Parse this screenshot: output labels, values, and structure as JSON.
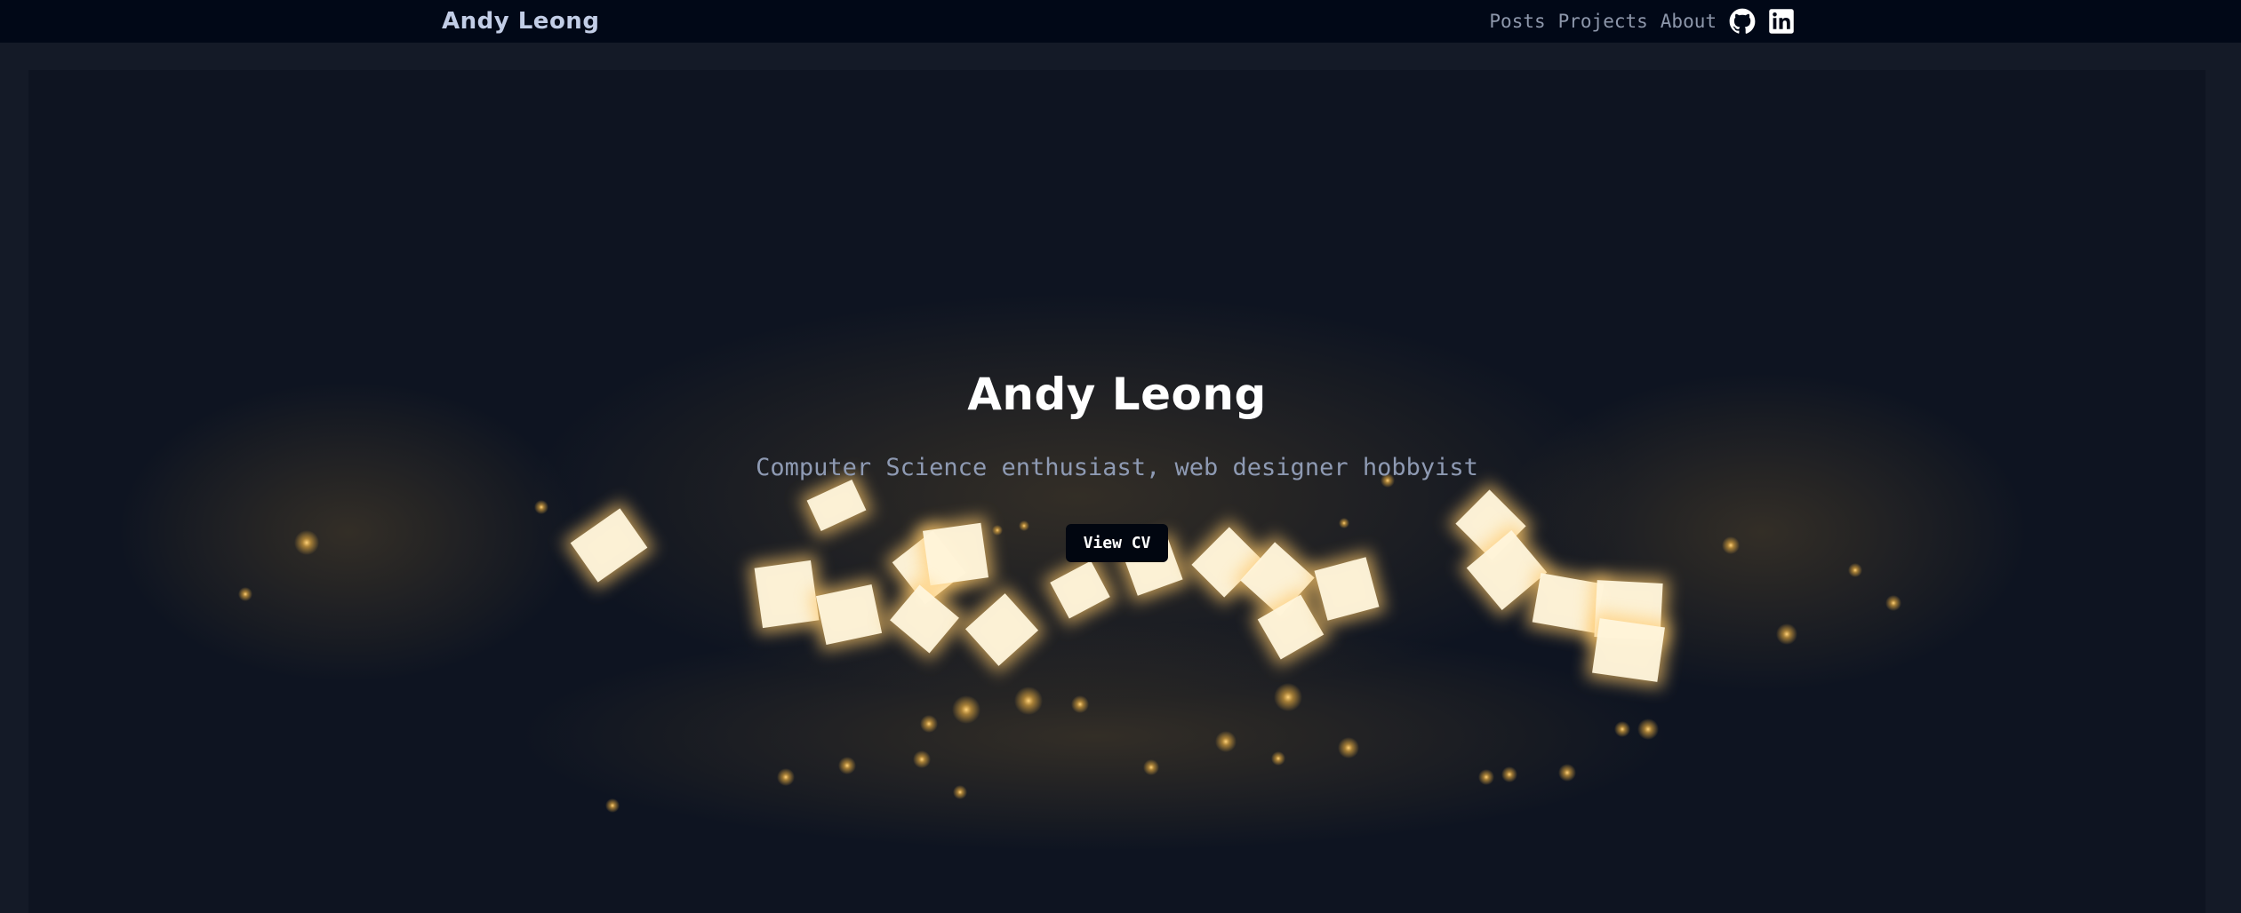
{
  "nav": {
    "brand": "Andy Leong",
    "links": [
      "Posts",
      "Projects",
      "About"
    ],
    "icons": [
      "github-icon",
      "linkedin-icon"
    ]
  },
  "hero": {
    "title": "Andy Leong",
    "subtitle": "Computer Science enthusiast, web designer hobbyist",
    "cv_button": "View CV"
  },
  "colors": {
    "navbar_bg": "#010817",
    "page_bg": "#141a27",
    "hero_bg": "#0e1421",
    "accent_glow": "#f5b642",
    "card_glow": "#fff6dc",
    "button_bg": "#010610"
  }
}
